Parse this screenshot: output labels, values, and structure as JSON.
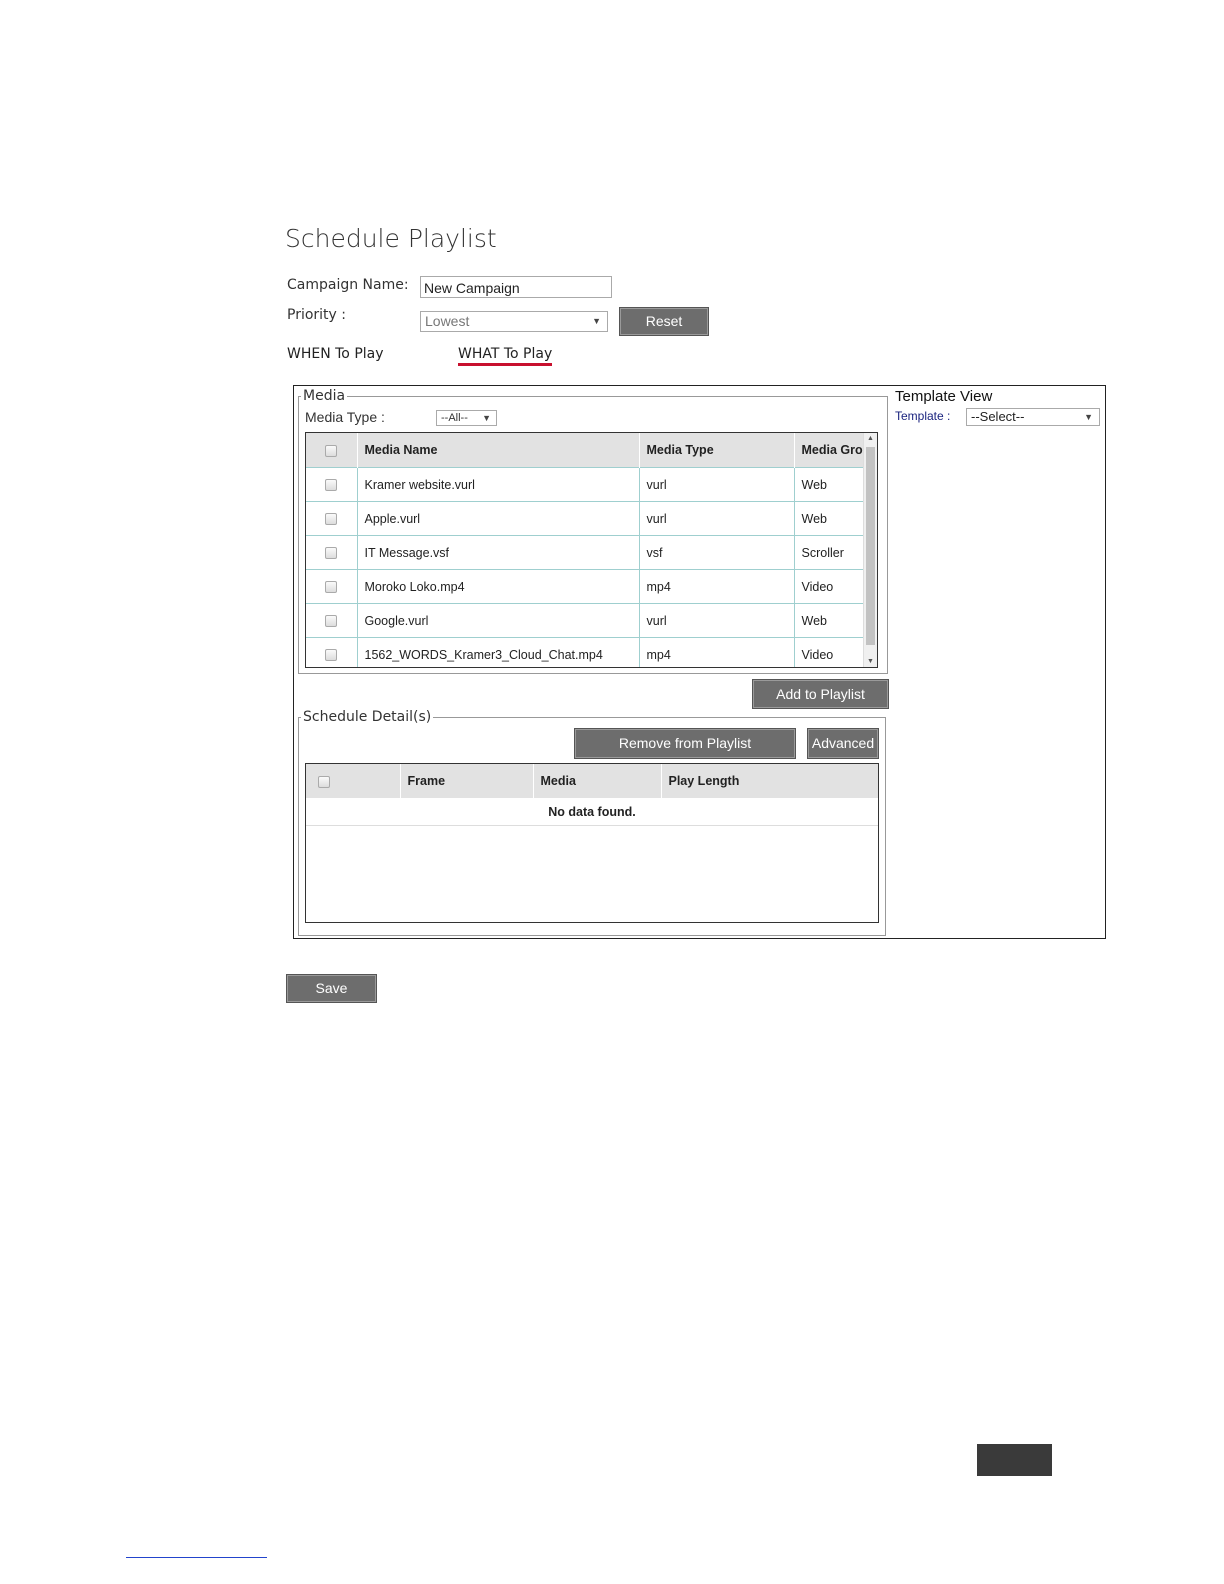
{
  "page": {
    "title": "Schedule Playlist"
  },
  "form": {
    "campaign_label": "Campaign Name:",
    "campaign_value": "New Campaign",
    "priority_label": "Priority :",
    "priority_value": "Lowest",
    "reset_label": "Reset"
  },
  "tabs": [
    {
      "label": "WHEN To Play",
      "active": false
    },
    {
      "label": "WHAT To Play",
      "active": true
    }
  ],
  "media": {
    "legend": "Media",
    "type_label": "Media Type :",
    "type_value": "--All--",
    "columns": [
      "Media Name",
      "Media Type",
      "Media Grou"
    ],
    "rows": [
      {
        "name": "Kramer website.vurl",
        "type": "vurl",
        "group": "Web"
      },
      {
        "name": "Apple.vurl",
        "type": "vurl",
        "group": "Web"
      },
      {
        "name": "IT Message.vsf",
        "type": "vsf",
        "group": "Scroller"
      },
      {
        "name": "Moroko Loko.mp4",
        "type": "mp4",
        "group": "Video"
      },
      {
        "name": "Google.vurl",
        "type": "vurl",
        "group": "Web"
      },
      {
        "name": "1562_WORDS_Kramer3_Cloud_Chat.mp4",
        "type": "mp4",
        "group": "Video"
      }
    ],
    "add_button": "Add to Playlist"
  },
  "schedule": {
    "legend": "Schedule Detail(s)",
    "remove_button": "Remove from Playlist",
    "advanced_button": "Advanced",
    "columns": [
      "Frame",
      "Media",
      "Play Length"
    ],
    "empty_text": "No data found."
  },
  "template_view": {
    "title": "Template View",
    "template_label": "Template :",
    "template_value": "--Select--"
  },
  "save_label": "Save",
  "colors": {
    "button_bg": "#6d6d6d",
    "tab_underline": "#c8102e",
    "row_border": "#9fcfcf",
    "header_bg": "#e2e2e2"
  }
}
